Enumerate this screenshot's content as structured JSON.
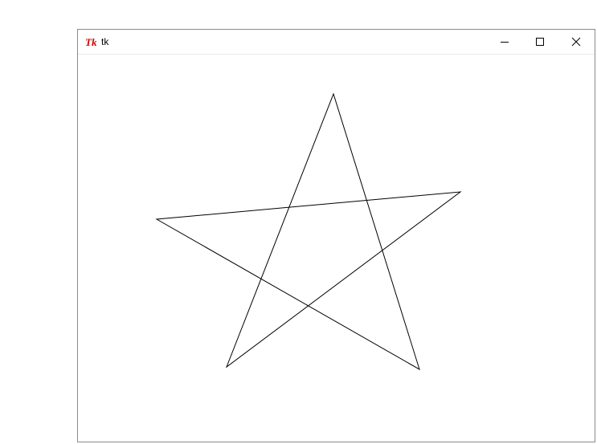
{
  "window": {
    "title": "tk",
    "app_icon": "tk-feather-icon",
    "caption_buttons": [
      "minimize-icon",
      "maximize-icon",
      "close-icon"
    ],
    "icon_color": "#d40000"
  },
  "canvas": {
    "background": "#ffffff",
    "shape": "five-pointed-star",
    "stroke": "#000000"
  }
}
